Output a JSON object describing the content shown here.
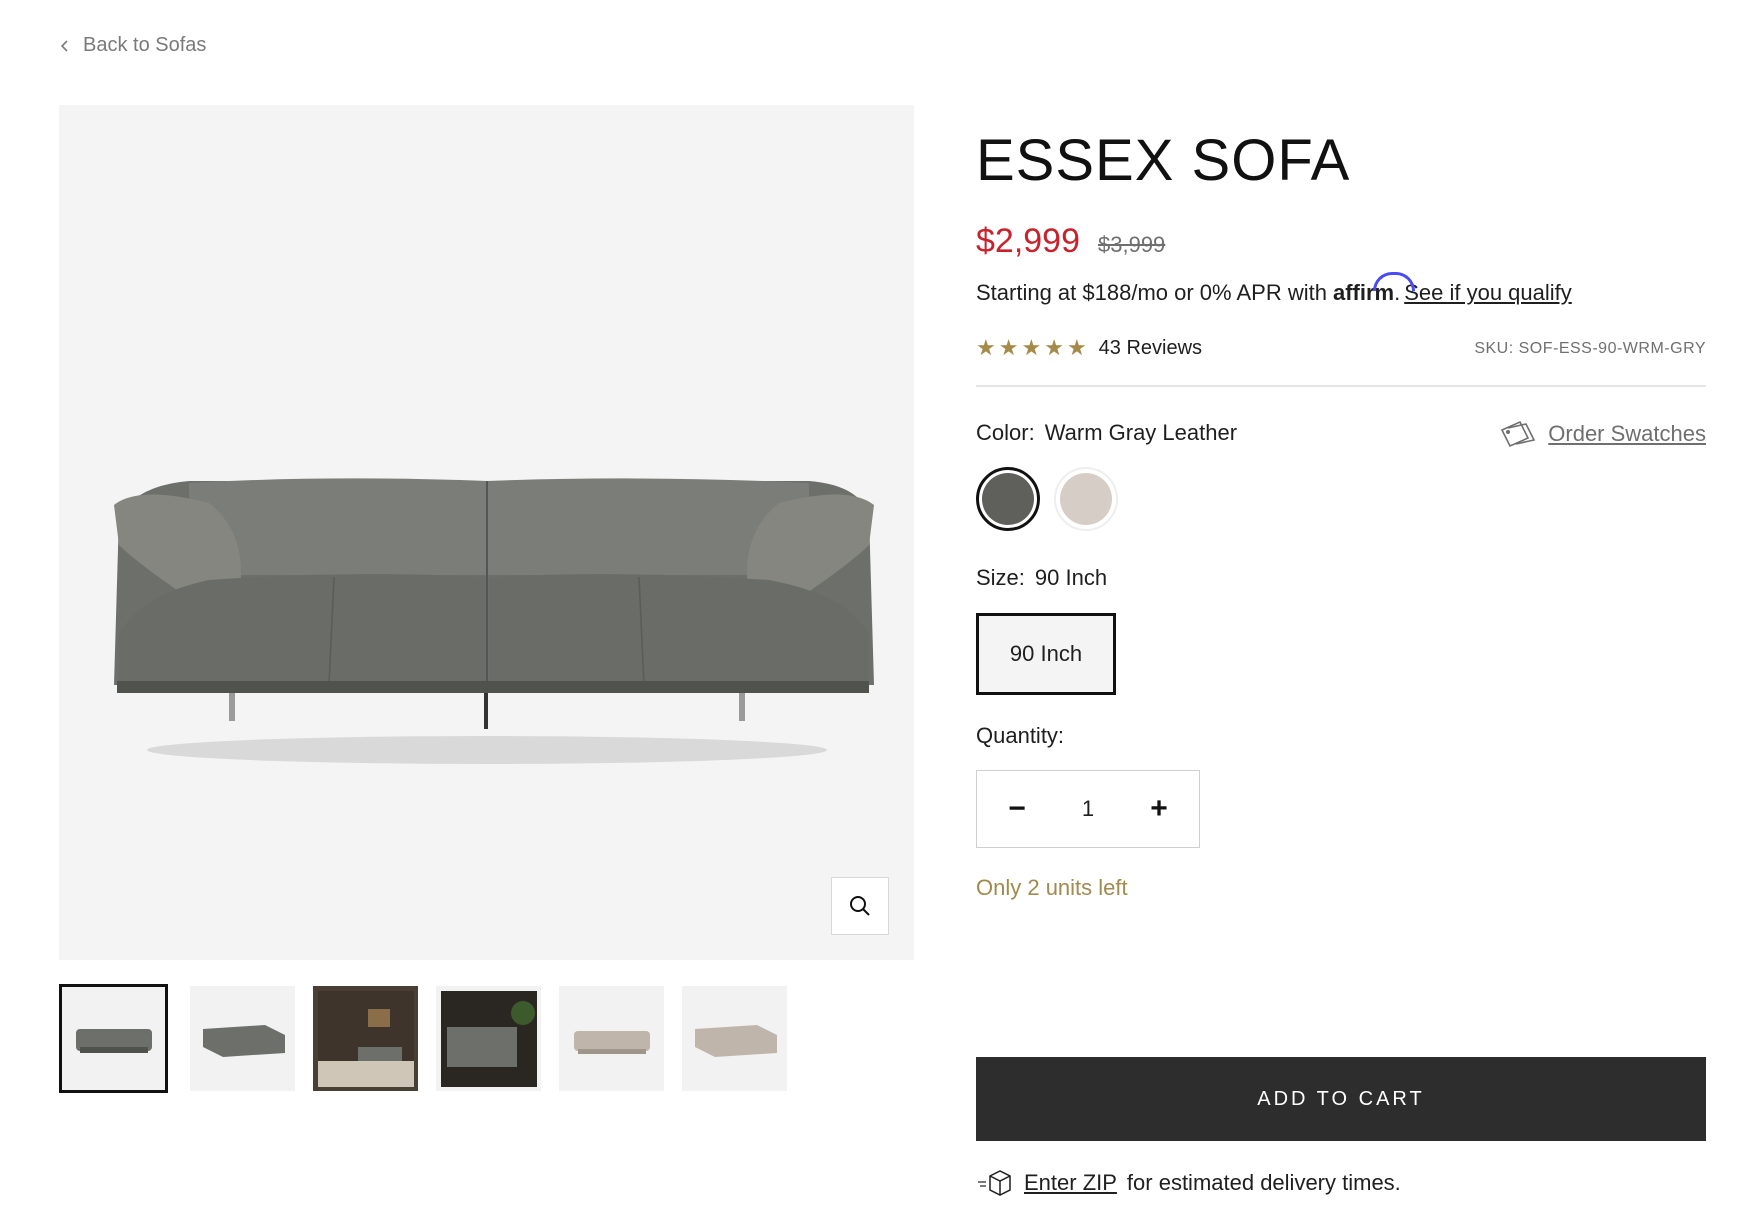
{
  "nav": {
    "back_label": "Back to Sofas"
  },
  "product": {
    "title": "ESSEX SOFA",
    "price_sale": "$2,999",
    "price_original": "$3,999",
    "financing": {
      "prefix": "Starting at $188/mo or 0% APR with",
      "brand": "affirm",
      "link": "See if you qualify"
    },
    "rating": {
      "stars": 5,
      "reviews_label": "43 Reviews"
    },
    "sku": "SKU: SOF-ESS-90-WRM-GRY",
    "color": {
      "label": "Color:",
      "value": "Warm Gray Leather",
      "order_swatches": "Order Swatches",
      "options": [
        {
          "name": "Warm Gray Leather",
          "hex": "#5f605c",
          "selected": true
        },
        {
          "name": "Beige",
          "hex": "#d6cec6",
          "selected": false
        }
      ]
    },
    "size": {
      "label": "Size:",
      "value": "90 Inch",
      "options": [
        "90 Inch"
      ]
    },
    "quantity": {
      "label": "Quantity:",
      "value": "1",
      "minus": "−",
      "plus": "+"
    },
    "stock_note": "Only 2 units left",
    "add_to_cart": "ADD TO CART",
    "delivery": {
      "link": "Enter ZIP",
      "suffix": "for estimated delivery times."
    }
  },
  "gallery": {
    "thumbnail_count": 6,
    "icons": [
      "zoom-icon"
    ]
  },
  "colors": {
    "sale": "#c8232c",
    "star": "#a58a48",
    "stock": "#a18a4e",
    "button": "#2d2d2d",
    "affirm": "#4a4af4"
  }
}
